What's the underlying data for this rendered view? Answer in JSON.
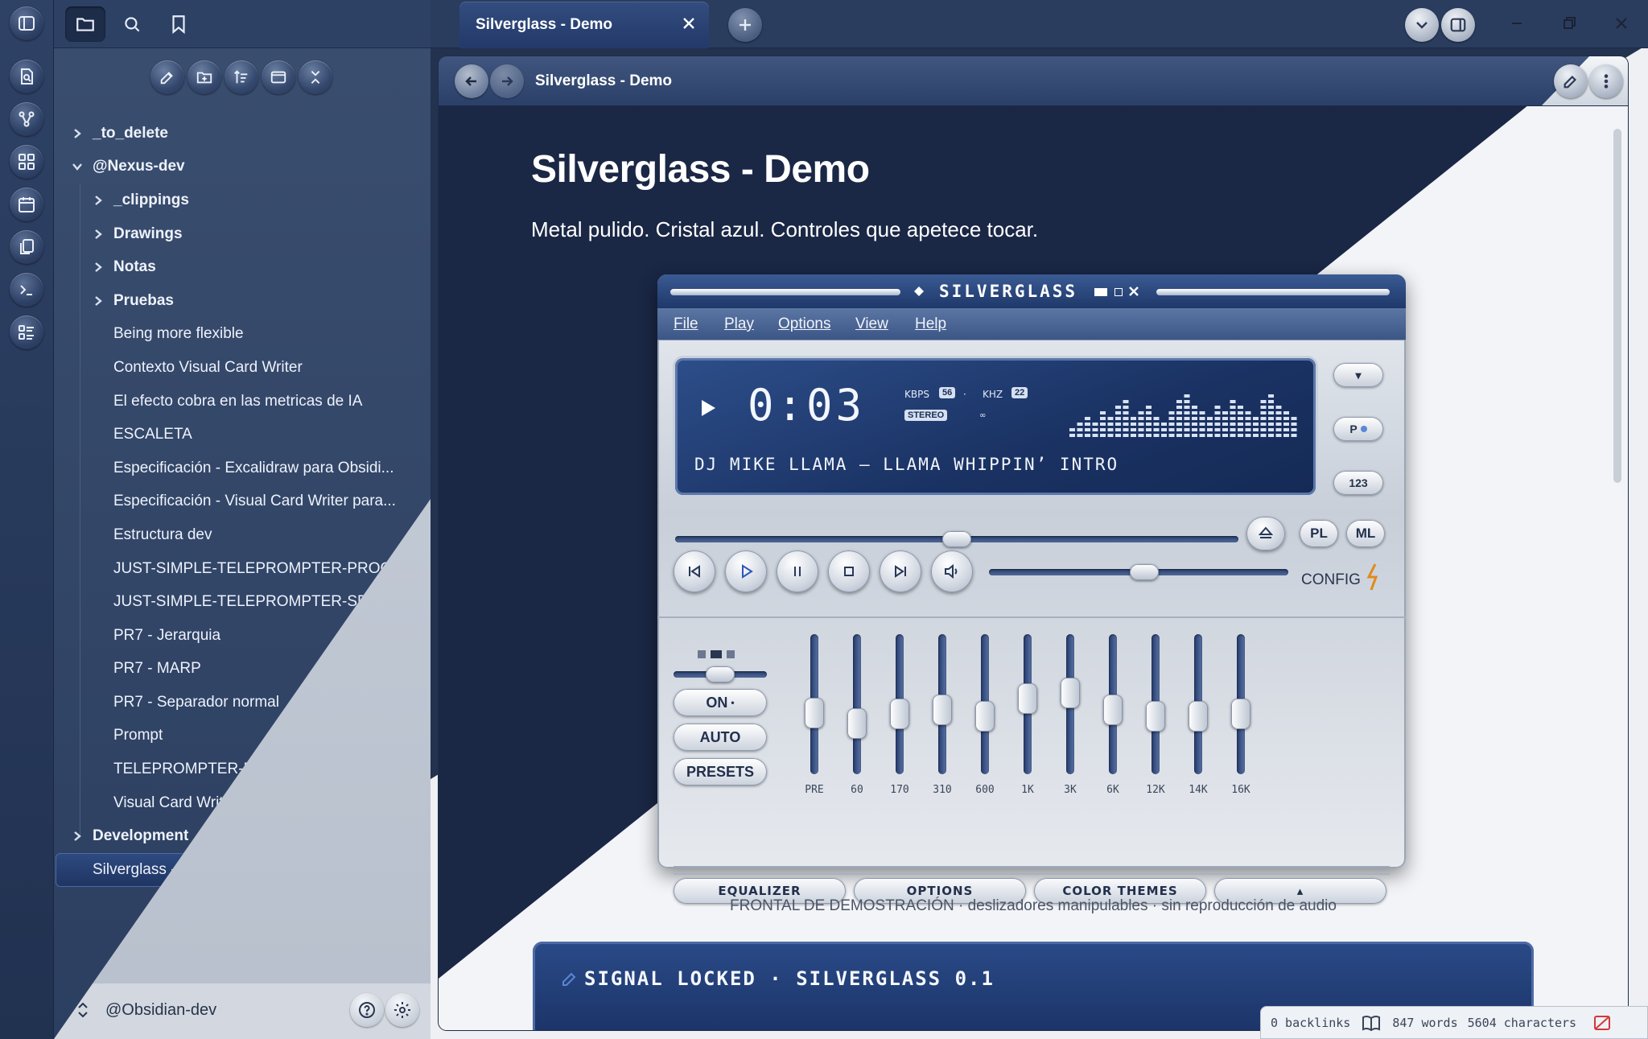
{
  "window": {
    "tab_title": "Silverglass - Demo"
  },
  "sidebar": {
    "tree": [
      {
        "label": "_to_delete",
        "type": "folder",
        "level": 0,
        "expanded": false
      },
      {
        "label": "@Nexus-dev",
        "type": "folder",
        "level": 0,
        "expanded": true
      },
      {
        "label": "_clippings",
        "type": "folder",
        "level": 1,
        "expanded": false
      },
      {
        "label": "Drawings",
        "type": "folder",
        "level": 1,
        "expanded": false
      },
      {
        "label": "Notas",
        "type": "folder",
        "level": 1,
        "expanded": false
      },
      {
        "label": "Pruebas",
        "type": "folder",
        "level": 1,
        "expanded": false
      },
      {
        "label": "Being more flexible",
        "type": "file",
        "level": 1
      },
      {
        "label": "Contexto Visual Card Writer",
        "type": "file",
        "level": 1
      },
      {
        "label": "El efecto cobra en las metricas de IA",
        "type": "file",
        "level": 1
      },
      {
        "label": "ESCALETA",
        "type": "file",
        "level": 1
      },
      {
        "label": "Especificación - Excalidraw para Obsidi...",
        "type": "file",
        "level": 1
      },
      {
        "label": "Especificación - Visual Card Writer para...",
        "type": "file",
        "level": 1
      },
      {
        "label": "Estructura dev",
        "type": "file",
        "level": 1
      },
      {
        "label": "JUST-SIMPLE-TELEPROMPTER-PROGR...",
        "type": "file",
        "level": 1
      },
      {
        "label": "JUST-SIMPLE-TELEPROMPTER-SPEC",
        "type": "file",
        "level": 1
      },
      {
        "label": "PR7 - Jerarquia",
        "type": "file",
        "level": 1
      },
      {
        "label": "PR7 - MARP",
        "type": "file",
        "level": 1
      },
      {
        "label": "PR7 - Separador normal",
        "type": "file",
        "level": 1
      },
      {
        "label": "Prompt",
        "type": "file",
        "level": 1
      },
      {
        "label": "TELEPROMPTER-DEMO",
        "type": "file",
        "level": 1
      },
      {
        "label": "Visual Card Writer - demo completa ES",
        "type": "file",
        "level": 1
      },
      {
        "label": "Development",
        "type": "folder",
        "level": 0,
        "expanded": false
      },
      {
        "label": "Silverglass - Demo",
        "type": "file",
        "level": 0,
        "selected": true
      }
    ],
    "vault_name": "@Obsidian-dev"
  },
  "view": {
    "breadcrumb": "Silverglass - Demo",
    "title": "Silverglass - Demo",
    "subtitle": "Metal pulido. Cristal azul. Controles que apetece tocar.",
    "caption": "FRONTAL DE DEMOSTRACIÓN · deslizadores manipulables · sin reproducción de audio",
    "signal_text": "SIGNAL LOCKED · SILVERGLASS 0.1"
  },
  "player": {
    "title": "SILVERGLASS",
    "menu": [
      "File",
      "Play",
      "Options",
      "View",
      "Help"
    ],
    "time": "0:03",
    "kbps_label": "KBPS",
    "kbps": "56",
    "khz_label": "KHZ",
    "khz": "22",
    "stereo": "STEREO",
    "track": "DJ MIKE LLAMA — LLAMA WHIPPIN’ INTRO",
    "side_buttons": [
      "▾",
      "P",
      "123"
    ],
    "pills": [
      "PL",
      "ML"
    ],
    "config_label": "CONFIG",
    "seek_position": 0.5,
    "volume_position": 0.52,
    "eq_buttons": [
      "ON",
      "AUTO",
      "PRESETS"
    ],
    "eq_bands": [
      {
        "label": "PRE",
        "level": 0.42
      },
      {
        "label": "60",
        "level": 0.32
      },
      {
        "label": "170",
        "level": 0.41
      },
      {
        "label": "310",
        "level": 0.45
      },
      {
        "label": "600",
        "level": 0.39
      },
      {
        "label": "1K",
        "level": 0.55
      },
      {
        "label": "3K",
        "level": 0.6
      },
      {
        "label": "6K",
        "level": 0.45
      },
      {
        "label": "12K",
        "level": 0.39
      },
      {
        "label": "14K",
        "level": 0.39
      },
      {
        "label": "16K",
        "level": 0.41
      }
    ],
    "tabs": [
      "EQUALIZER",
      "OPTIONS",
      "COLOR THEMES",
      "▴"
    ]
  },
  "status": {
    "backlinks": "0 backlinks",
    "words": "847 words",
    "characters": "5604 characters"
  },
  "colors": {
    "accent": "#23396a",
    "lcd": "#1a3263",
    "chrome": "#c8cfd9"
  }
}
